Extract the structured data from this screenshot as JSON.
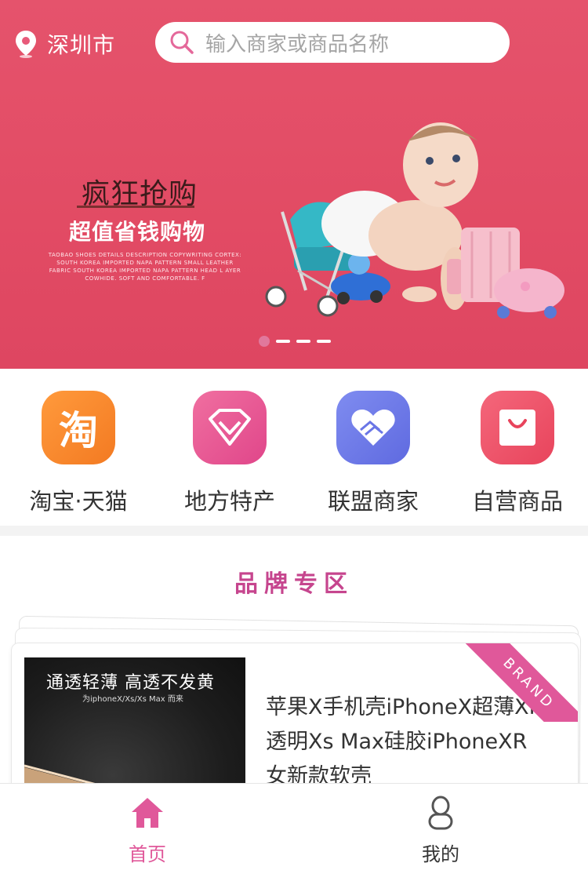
{
  "header": {
    "city": "深圳市",
    "search_placeholder": "输入商家或商品名称"
  },
  "banner": {
    "title": "疯狂抢购",
    "subtitle": "超值省钱购物",
    "fine_print": "TAOBAO SHOES DETAILS DESCRIPTION COPYWRITING CORTEX: SOUTH KOREA IMPORTED NAPA PATTERN SMALL LEATHER FABRIC SOUTH KOREA IMPORTED NAPA PATTERN HEAD L AYER COWHIDE. SOFT AND COMFORTABLE. F"
  },
  "categories": [
    {
      "label": "淘宝·天猫",
      "icon": "taobao-icon",
      "glyph": "淘"
    },
    {
      "label": "地方特产",
      "icon": "diamond-icon"
    },
    {
      "label": "联盟商家",
      "icon": "heart-handshake-icon"
    },
    {
      "label": "自营商品",
      "icon": "shopping-bag-icon"
    }
  ],
  "brand": {
    "title": "品牌专区",
    "ribbon": "BRAND",
    "product": {
      "image_headline": "通透轻薄 高透不发黄",
      "image_subline": "为iphoneX/Xs/Xs Max 而来",
      "name": "苹果X手机壳iPhoneX超薄XR透明Xs Max硅胶iPhoneXR女新款软壳"
    }
  },
  "tabbar": [
    {
      "label": "首页",
      "icon": "home-icon",
      "active": true
    },
    {
      "label": "我的",
      "icon": "user-icon",
      "active": false
    }
  ],
  "colors": {
    "banner_bg": "#e24b64",
    "accent_pink": "#e0589a",
    "brand_title": "#c6458e",
    "tab_active": "#e0589a"
  }
}
